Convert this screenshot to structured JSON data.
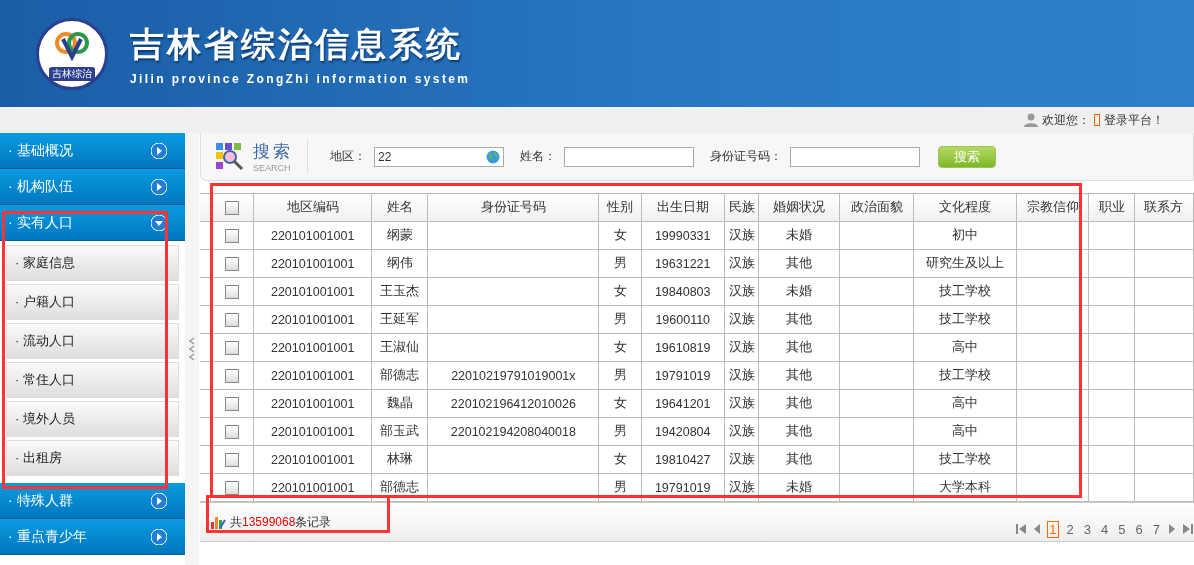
{
  "header": {
    "logo_text": "吉林综治",
    "title": "吉林省综治信息系统",
    "subtitle": "Jilin province ZongZhi information system"
  },
  "top_bar": {
    "welcome": "欢迎您：",
    "login": "登录平台！"
  },
  "sidebar": {
    "items": [
      {
        "label": "· 基础概况",
        "expanded": false
      },
      {
        "label": "· 机构队伍",
        "expanded": false
      },
      {
        "label": "· 实有人口",
        "expanded": true,
        "children": [
          {
            "label": "· 家庭信息"
          },
          {
            "label": "· 户籍人口"
          },
          {
            "label": "· 流动人口"
          },
          {
            "label": "· 常住人口"
          },
          {
            "label": "· 境外人员"
          },
          {
            "label": "· 出租房"
          }
        ]
      },
      {
        "label": "· 特殊人群",
        "expanded": false
      },
      {
        "label": "· 重点青少年",
        "expanded": false
      }
    ]
  },
  "search": {
    "title": "搜索",
    "subtitle": "SEARCH",
    "fields": [
      {
        "label": "地区：",
        "value": "22",
        "kind": "region"
      },
      {
        "label": "姓名：",
        "kind": "text"
      },
      {
        "label": "身份证号码：",
        "kind": "text"
      }
    ],
    "button": "搜索"
  },
  "table": {
    "select_all": {
      "checked": false
    },
    "columns": [
      "地区编码",
      "姓名",
      "身份证号码",
      "性别",
      "出生日期",
      "民族",
      "婚姻状况",
      "政治面貌",
      "文化程度",
      "宗教信仰",
      "职业",
      "联系方"
    ],
    "rows": [
      {
        "checked": false,
        "cells": [
          "220101001001",
          "纲蒙",
          "",
          "女",
          "19990331",
          "汉族",
          "未婚",
          "",
          "初中",
          "",
          "",
          ""
        ]
      },
      {
        "checked": false,
        "cells": [
          "220101001001",
          "纲伟",
          "",
          "男",
          "19631221",
          "汉族",
          "其他",
          "",
          "研究生及以上",
          "",
          "",
          ""
        ]
      },
      {
        "checked": false,
        "cells": [
          "220101001001",
          "王玉杰",
          "",
          "女",
          "19840803",
          "汉族",
          "未婚",
          "",
          "技工学校",
          "",
          "",
          ""
        ]
      },
      {
        "checked": false,
        "cells": [
          "220101001001",
          "王延军",
          "",
          "男",
          "19600110",
          "汉族",
          "其他",
          "",
          "技工学校",
          "",
          "",
          ""
        ]
      },
      {
        "checked": false,
        "cells": [
          "220101001001",
          "王淑仙",
          "",
          "女",
          "19610819",
          "汉族",
          "其他",
          "",
          "高中",
          "",
          "",
          ""
        ]
      },
      {
        "checked": false,
        "cells": [
          "220101001001",
          "部德志",
          "22010219791019001x",
          "男",
          "19791019",
          "汉族",
          "其他",
          "",
          "技工学校",
          "",
          "",
          ""
        ]
      },
      {
        "checked": false,
        "cells": [
          "220101001001",
          "魏晶",
          "220102196412010026",
          "女",
          "19641201",
          "汉族",
          "其他",
          "",
          "高中",
          "",
          "",
          ""
        ]
      },
      {
        "checked": false,
        "cells": [
          "220101001001",
          "部玉武",
          "220102194208040018",
          "男",
          "19420804",
          "汉族",
          "其他",
          "",
          "高中",
          "",
          "",
          ""
        ]
      },
      {
        "checked": false,
        "cells": [
          "220101001001",
          "林琳",
          "",
          "女",
          "19810427",
          "汉族",
          "其他",
          "",
          "技工学校",
          "",
          "",
          ""
        ]
      },
      {
        "checked": false,
        "cells": [
          "220101001001",
          "部德志",
          "",
          "男",
          "19791019",
          "汉族",
          "未婚",
          "",
          "大学本科",
          "",
          "",
          ""
        ]
      }
    ]
  },
  "footer": {
    "prefix": "共",
    "count": "13599068",
    "suffix": "条记录"
  },
  "pagination": {
    "pages": [
      {
        "label": "1",
        "selected": true
      },
      {
        "label": "2",
        "selected": false
      },
      {
        "label": "3",
        "selected": false
      },
      {
        "label": "4",
        "selected": false
      },
      {
        "label": "5",
        "selected": false
      },
      {
        "label": "6",
        "selected": false
      },
      {
        "label": "7",
        "selected": false
      }
    ]
  }
}
